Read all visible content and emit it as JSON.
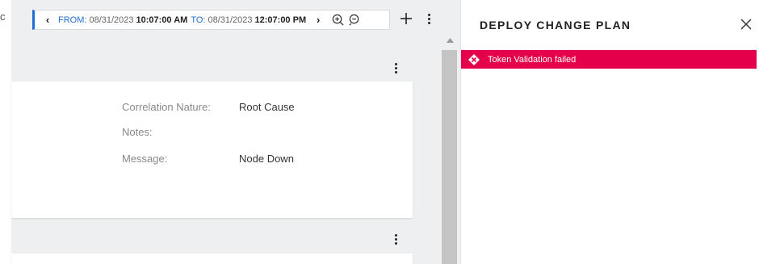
{
  "left_strip": {
    "char": "c"
  },
  "timebar": {
    "prev_icon": "chevron-left-icon",
    "from_label": "FROM:",
    "from_date": "08/31/2023",
    "from_time": "10:07:00 AM",
    "to_label": "TO:",
    "to_date": "08/31/2023",
    "to_time": "12:07:00 PM",
    "next_icon": "chevron-right-icon",
    "zoom_in_icon": "zoom-in-icon",
    "zoom_out_icon": "zoom-out-icon"
  },
  "card": {
    "fields": [
      {
        "label": "Correlation Nature:",
        "value": "Root Cause"
      },
      {
        "label": "Notes:",
        "value": ""
      },
      {
        "label": "Message:",
        "value": "Node Down"
      }
    ]
  },
  "panel": {
    "title": "DEPLOY CHANGE PLAN",
    "error_message": "Token Validation failed",
    "error_color": "#e5004c"
  },
  "colors": {
    "accent": "#1f6fd0",
    "background": "#eeeff1"
  }
}
